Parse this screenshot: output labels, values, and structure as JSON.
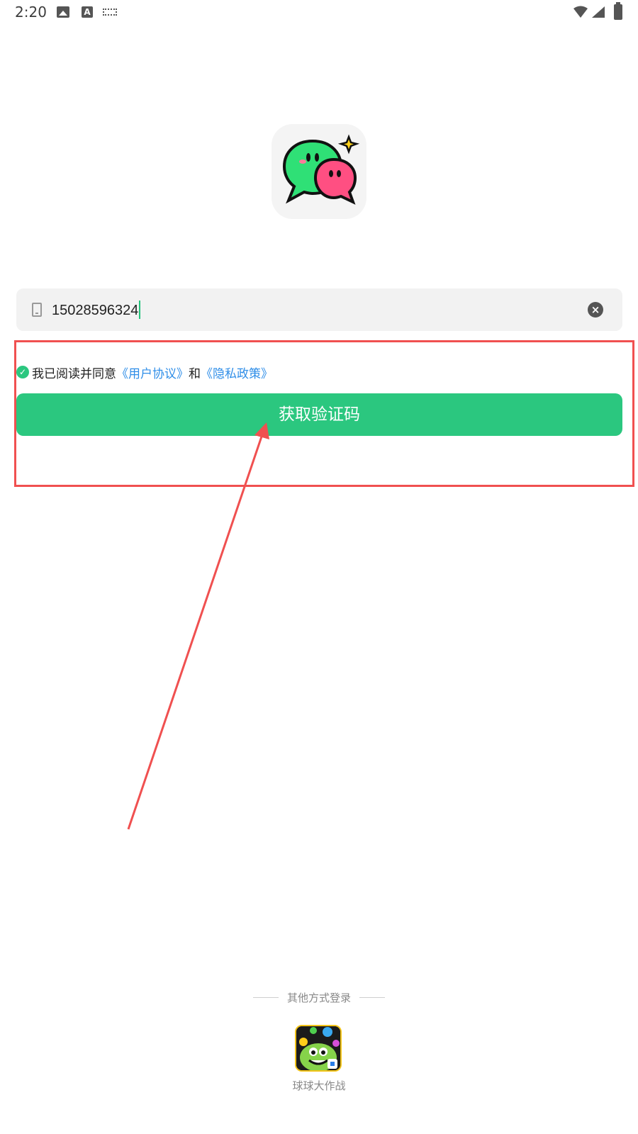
{
  "status_bar": {
    "time": "2:20"
  },
  "login": {
    "phone_value": "15028596324"
  },
  "agreement": {
    "prefix": "我已阅读并同意",
    "user_agreement": "《用户协议》",
    "conjunction": "和",
    "privacy_policy": "《隐私政策》"
  },
  "get_code_button": "获取验证码",
  "other_login": {
    "title": "其他方式登录",
    "providers": [
      {
        "label": "球球大作战"
      }
    ]
  },
  "colors": {
    "accent_green": "#2bc77f",
    "link_blue": "#2f8ee8",
    "annotation_red": "#f05050"
  }
}
